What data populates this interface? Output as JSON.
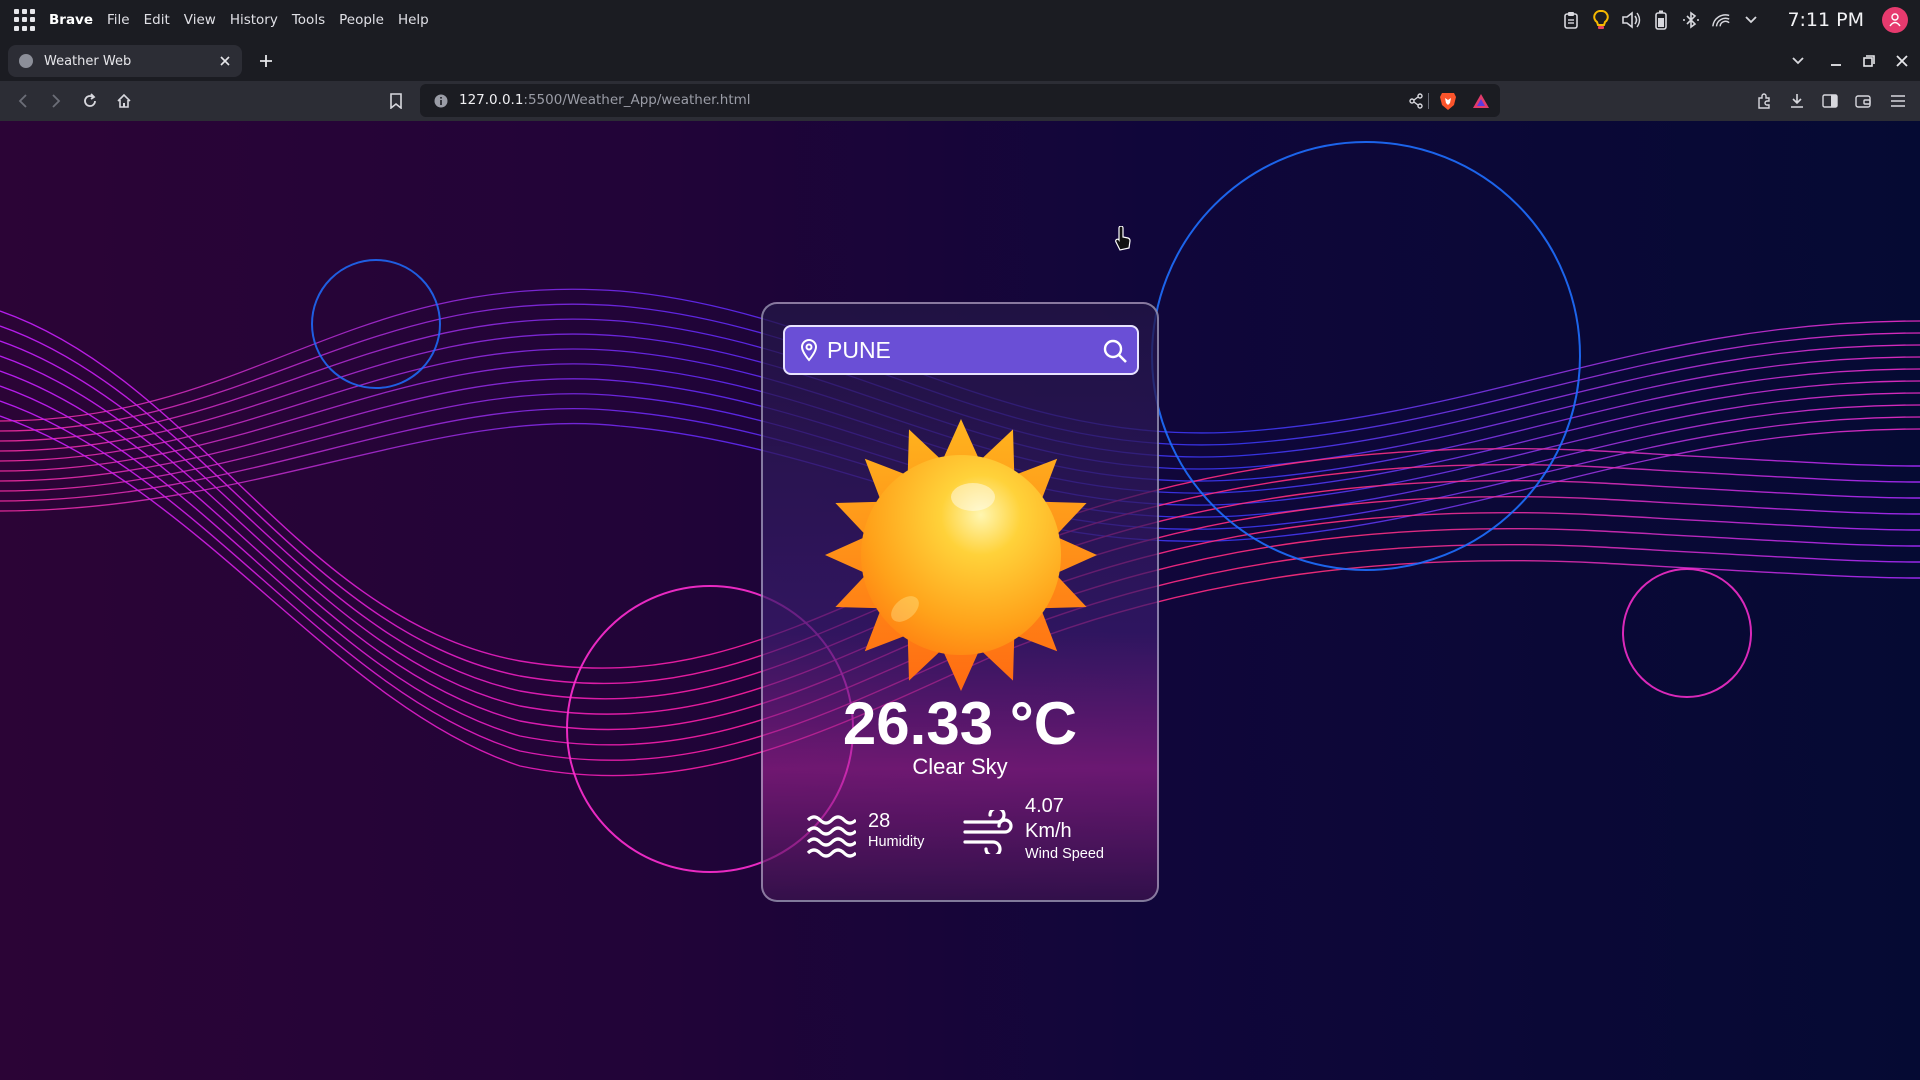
{
  "os": {
    "menu": [
      "Brave",
      "File",
      "Edit",
      "View",
      "History",
      "Tools",
      "People",
      "Help"
    ],
    "clock": "7:11 PM",
    "tray_icons": [
      "clipboard-icon",
      "lightbulb-icon",
      "volume-icon",
      "battery-icon",
      "bluetooth-icon",
      "wifi-icon",
      "chevron-down-icon"
    ]
  },
  "browser": {
    "tab_title": "Weather Web",
    "url_host": "127.0.0.1",
    "url_rest": ":5500/Weather_App/weather.html"
  },
  "weather": {
    "search_value": "PUNE",
    "temperature": "26.33 °C",
    "description": "Clear Sky",
    "humidity_value": "28",
    "humidity_label": "Humidity",
    "wind_value": "4.07 Km/h",
    "wind_label": "Wind Speed"
  },
  "colors": {
    "accent_search": "#6a4fd6",
    "brave_orange": "#fb542b",
    "pink": "#ff2fa8",
    "blue": "#1e7bff"
  }
}
